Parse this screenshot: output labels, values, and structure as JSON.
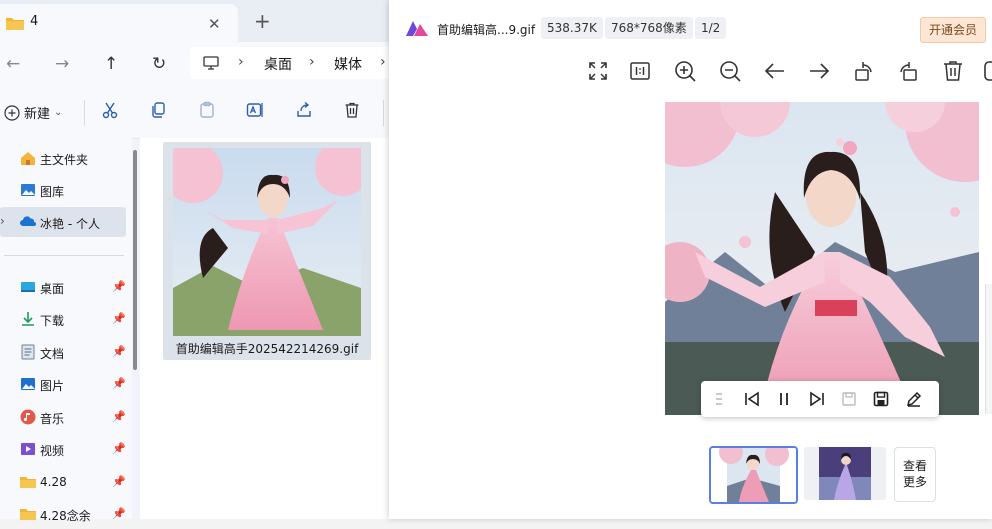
{
  "explorer": {
    "tab_title": "4",
    "tab_close": "✕",
    "new_tab": "+",
    "nav": {
      "back": "←",
      "forward": "→",
      "up": "↑",
      "refresh": "↻"
    },
    "address": {
      "segments": [
        "桌面",
        "媒体"
      ],
      "sep": "›"
    },
    "command": {
      "new_label": "新建",
      "new_caret": "⌄"
    },
    "sidebar": {
      "items": [
        {
          "label": "主文件夹",
          "icon": "home-icon"
        },
        {
          "label": "图库",
          "icon": "gallery-icon"
        },
        {
          "label": "冰艳 - 个人",
          "icon": "onedrive-icon"
        },
        {
          "label": "桌面",
          "icon": "desktop-icon",
          "pin": "📌"
        },
        {
          "label": "下载",
          "icon": "download-icon",
          "pin": "📌"
        },
        {
          "label": "文档",
          "icon": "document-icon",
          "pin": "📌"
        },
        {
          "label": "图片",
          "icon": "pictures-icon",
          "pin": "📌"
        },
        {
          "label": "音乐",
          "icon": "music-icon",
          "pin": "📌"
        },
        {
          "label": "视频",
          "icon": "video-icon",
          "pin": "📌"
        },
        {
          "label": "4.28",
          "icon": "folder-icon",
          "pin": "📌"
        },
        {
          "label": "4.28念余",
          "icon": "folder-icon",
          "pin": "📌"
        }
      ],
      "expand_caret": "›"
    },
    "file": {
      "name": "首助编辑高手202542214269.gif"
    }
  },
  "viewer": {
    "file_name": "首助编辑高...9.gif",
    "file_size": "538.37K",
    "dimensions": "768*768像素",
    "page_index": "1/2",
    "vip_label": "开通会员",
    "more_label_1": "查看",
    "more_label_2": "更多"
  },
  "colors": {
    "accent": "#5b7fe0",
    "vip_bg": "#fde6d4",
    "sky": "#c9dbee",
    "pink": "#f1a7c0",
    "sakura": "#f4c2d2"
  }
}
